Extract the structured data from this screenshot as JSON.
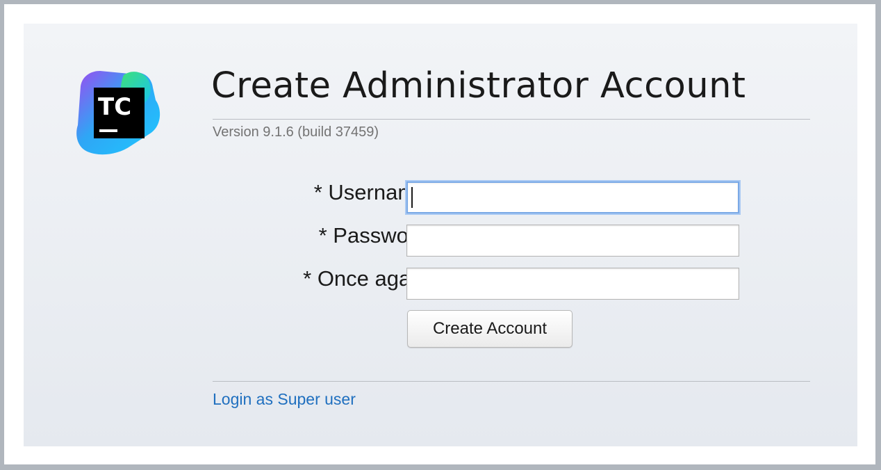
{
  "header": {
    "title": "Create Administrator Account",
    "version": "Version 9.1.6 (build 37459)"
  },
  "logo": {
    "text": "TC",
    "icon": "teamcity-logo-icon"
  },
  "form": {
    "username_label": "* Username:",
    "password_label": "* Password:",
    "confirm_label": "* Once again:",
    "username_value": "",
    "password_value": "",
    "confirm_value": "",
    "submit_label": "Create Account"
  },
  "footer": {
    "super_user_link": "Login as Super user"
  },
  "colors": {
    "link": "#1f6fbf",
    "focus_ring": "#7aa9e6"
  }
}
